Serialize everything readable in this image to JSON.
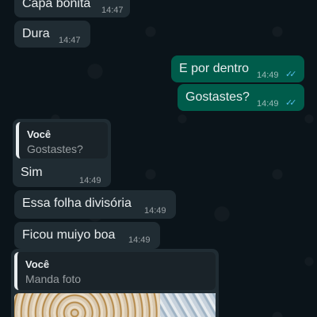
{
  "messages": [
    {
      "text": "Capa bonita",
      "time": "14:47"
    },
    {
      "text": "Dura",
      "time": "14:47"
    },
    {
      "text": "E por dentro",
      "time": "14:49"
    },
    {
      "text": "Gostastes?",
      "time": "14:49"
    },
    {
      "quote_author": "Você",
      "quote_text": "Gostastes?",
      "text": "Sim",
      "time": "14:49"
    },
    {
      "text": "Essa folha divisória",
      "time": "14:49"
    },
    {
      "text": "Ficou muiyo boa",
      "time": "14:49"
    },
    {
      "quote_author": "Você",
      "quote_text": "Manda foto"
    }
  ],
  "ticks": "✓✓",
  "colors": {
    "background": "#0b141a",
    "incoming_bubble": "#202c33",
    "outgoing_bubble": "#005c4b",
    "read_ticks": "#53bdeb"
  }
}
